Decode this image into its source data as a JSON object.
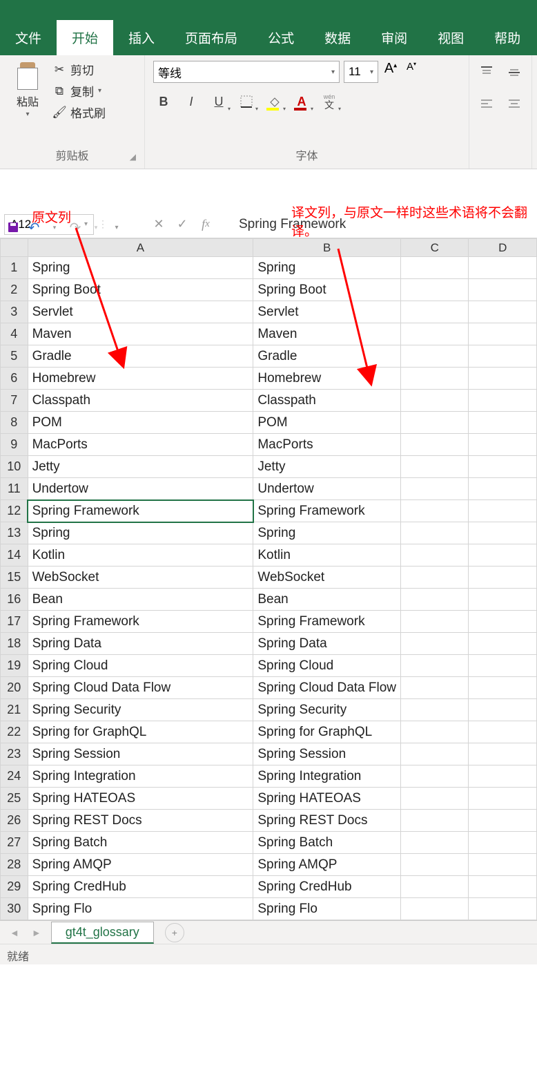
{
  "tabs": [
    "文件",
    "开始",
    "插入",
    "页面布局",
    "公式",
    "数据",
    "审阅",
    "视图",
    "帮助"
  ],
  "active_tab": 1,
  "clipboard": {
    "paste": "粘贴",
    "cut": "剪切",
    "copy": "复制",
    "format_painter": "格式刷",
    "group": "剪贴板"
  },
  "font": {
    "name": "等线",
    "size": "11",
    "group": "字体",
    "wen": "wén",
    "wen_char": "文"
  },
  "annotations": {
    "a1": "原文列",
    "a2": "译文列，与原文一样时这些术语将不会翻译。"
  },
  "name_box": "A12",
  "formula_value": "Spring Framework",
  "columns": [
    "A",
    "B",
    "C",
    "D"
  ],
  "col_widths": {
    "A": 366,
    "B": 128,
    "C": 128,
    "D": 128
  },
  "selected": {
    "row": 12,
    "col": "A"
  },
  "rows": [
    {
      "n": 1,
      "A": "Spring",
      "B": "Spring"
    },
    {
      "n": 2,
      "A": "Spring Boot",
      "B": "Spring Boot"
    },
    {
      "n": 3,
      "A": "Servlet",
      "B": "Servlet"
    },
    {
      "n": 4,
      "A": "Maven",
      "B": "Maven"
    },
    {
      "n": 5,
      "A": "Gradle",
      "B": "Gradle"
    },
    {
      "n": 6,
      "A": "Homebrew",
      "B": "Homebrew"
    },
    {
      "n": 7,
      "A": "Classpath",
      "B": "Classpath"
    },
    {
      "n": 8,
      "A": "POM",
      "B": "POM"
    },
    {
      "n": 9,
      "A": "MacPorts",
      "B": "MacPorts"
    },
    {
      "n": 10,
      "A": "Jetty",
      "B": "Jetty"
    },
    {
      "n": 11,
      "A": "Undertow",
      "B": "Undertow"
    },
    {
      "n": 12,
      "A": "Spring Framework",
      "B": "Spring Framework"
    },
    {
      "n": 13,
      "A": "Spring",
      "B": "Spring"
    },
    {
      "n": 14,
      "A": "Kotlin",
      "B": "Kotlin"
    },
    {
      "n": 15,
      "A": "WebSocket",
      "B": "WebSocket"
    },
    {
      "n": 16,
      "A": "Bean",
      "B": "Bean"
    },
    {
      "n": 17,
      "A": "Spring Framework",
      "B": "Spring Framework"
    },
    {
      "n": 18,
      "A": "Spring Data",
      "B": "Spring Data"
    },
    {
      "n": 19,
      "A": "Spring Cloud",
      "B": "Spring Cloud"
    },
    {
      "n": 20,
      "A": "Spring Cloud Data Flow",
      "B": "Spring Cloud Data Flow"
    },
    {
      "n": 21,
      "A": "Spring Security",
      "B": "Spring Security"
    },
    {
      "n": 22,
      "A": "Spring for GraphQL",
      "B": "Spring for GraphQL"
    },
    {
      "n": 23,
      "A": "Spring Session",
      "B": "Spring Session"
    },
    {
      "n": 24,
      "A": "Spring Integration",
      "B": "Spring Integration"
    },
    {
      "n": 25,
      "A": "Spring HATEOAS",
      "B": "Spring HATEOAS"
    },
    {
      "n": 26,
      "A": "Spring REST Docs",
      "B": "Spring REST Docs"
    },
    {
      "n": 27,
      "A": "Spring Batch",
      "B": "Spring Batch"
    },
    {
      "n": 28,
      "A": "Spring AMQP",
      "B": "Spring AMQP"
    },
    {
      "n": 29,
      "A": "Spring CredHub",
      "B": "Spring CredHub"
    },
    {
      "n": 30,
      "A": "Spring Flo",
      "B": "Spring Flo"
    }
  ],
  "sheet_tab": "gt4t_glossary",
  "status": "就绪"
}
